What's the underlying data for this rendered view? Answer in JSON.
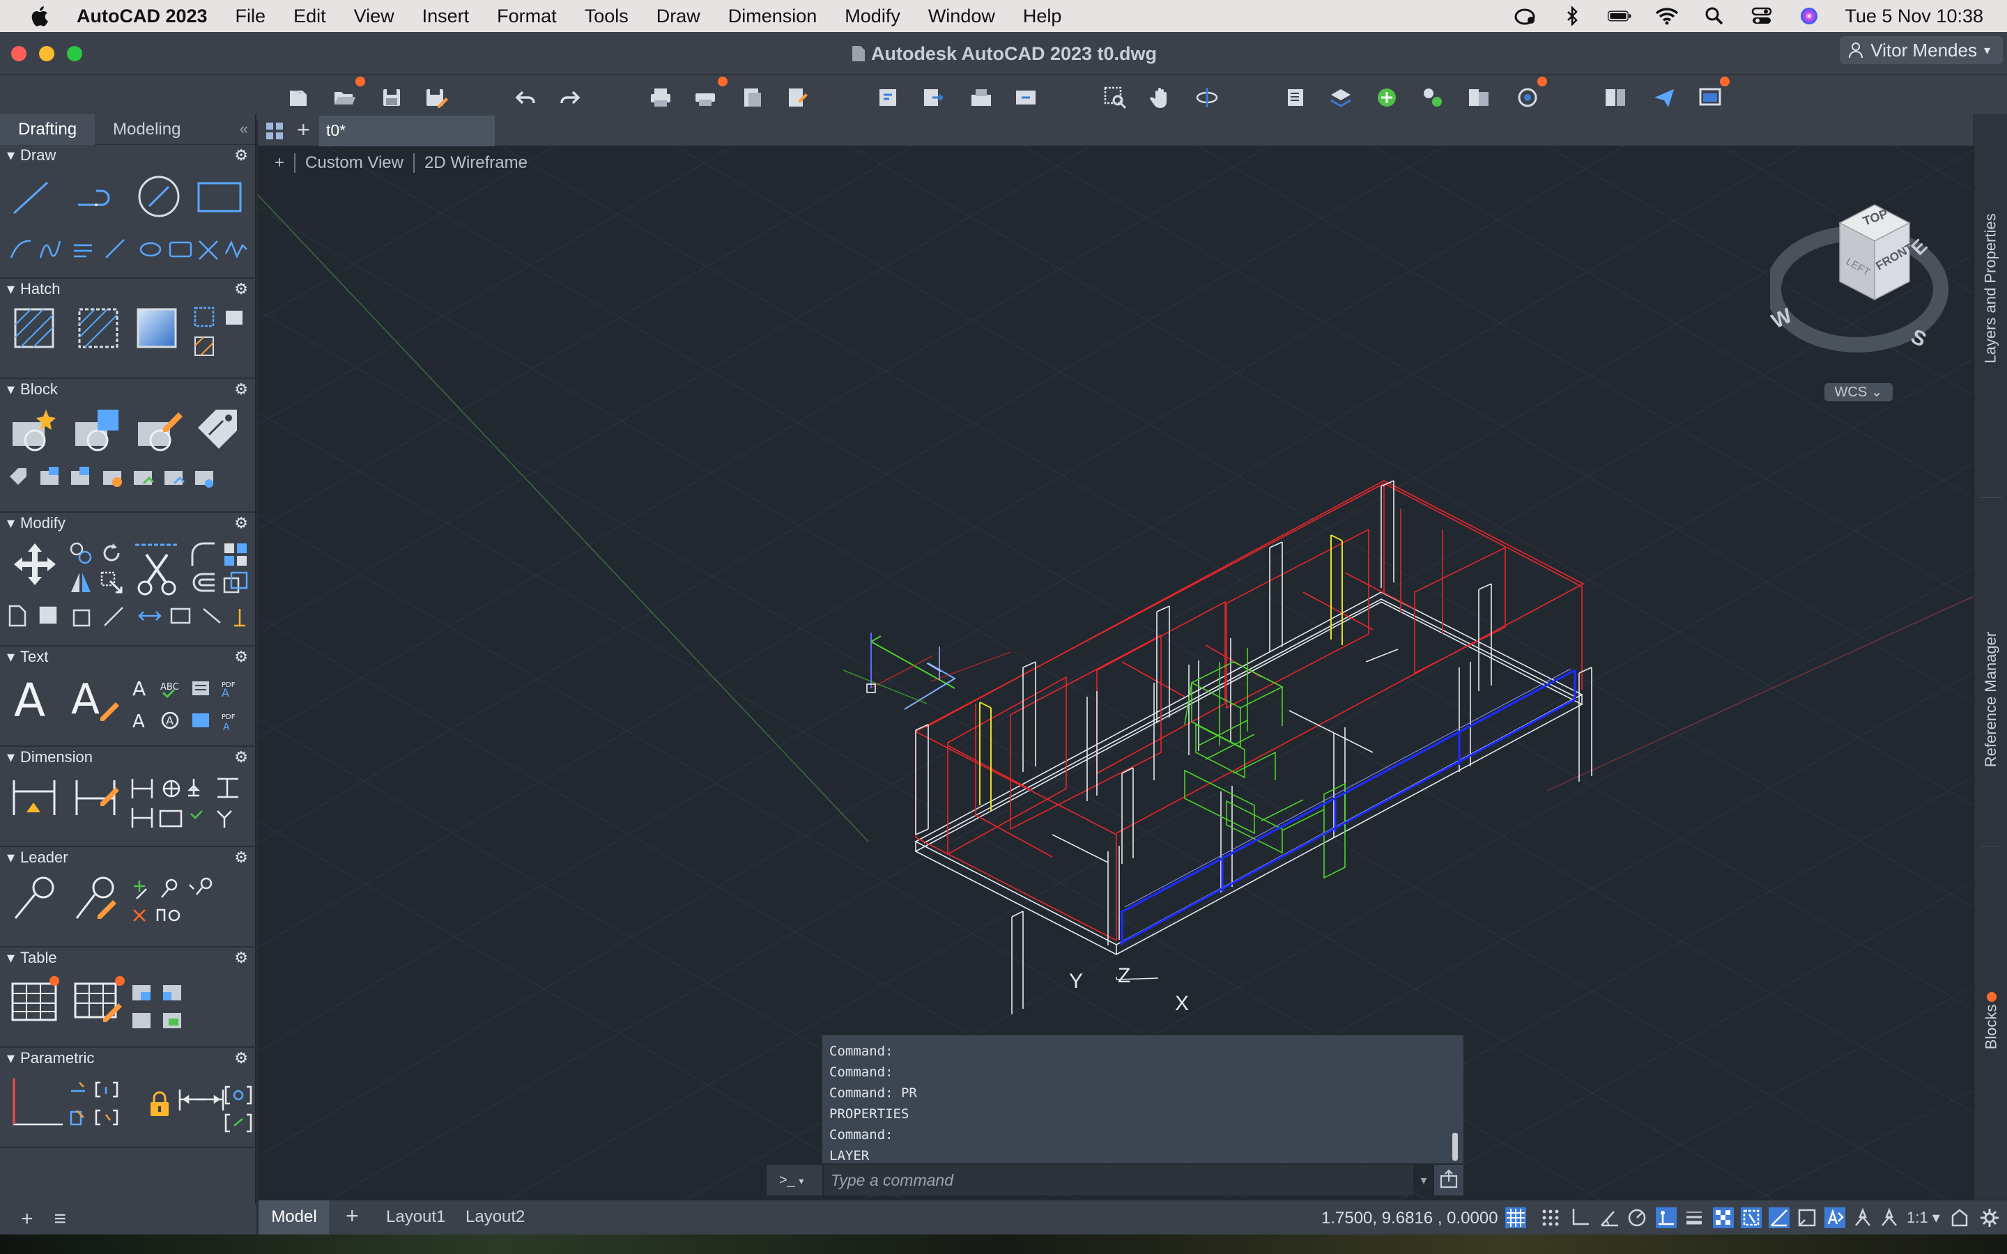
{
  "menubar": {
    "app_name": "AutoCAD 2023",
    "items": [
      "File",
      "Edit",
      "View",
      "Insert",
      "Format",
      "Tools",
      "Draw",
      "Dimension",
      "Modify",
      "Window",
      "Help"
    ],
    "clock": "Tue 5 Nov  10:38"
  },
  "window": {
    "title": "Autodesk AutoCAD 2023    t0.dwg",
    "user": "Vitor Mendes"
  },
  "palette": {
    "tabs": [
      "Drafting",
      "Modeling"
    ],
    "sections": [
      "Draw",
      "Hatch",
      "Block",
      "Modify",
      "Text",
      "Dimension",
      "Leader",
      "Table",
      "Parametric"
    ]
  },
  "doc_tab": "t0*",
  "view_controls": {
    "plus": "+",
    "view": "Custom View",
    "style": "2D Wireframe"
  },
  "viewcube": {
    "top": "TOP",
    "front": "FRONT",
    "left": "LEFT",
    "compass": [
      "W",
      "S",
      "E"
    ],
    "wcs": "WCS"
  },
  "ucs": {
    "x": "X",
    "y": "Y",
    "z": "Z"
  },
  "right_tabs": [
    "Layers and Properties",
    "Reference Manager",
    "Blocks"
  ],
  "command": {
    "history": [
      "Command:",
      "Command:",
      "Command: PR",
      "PROPERTIES",
      "Command:",
      "LAYER"
    ],
    "prompt": ">_",
    "placeholder": "Type a command"
  },
  "status": {
    "layouts": [
      "Model",
      "Layout1",
      "Layout2"
    ],
    "coords": "1.7500, 9.6816 , 0.0000",
    "scale": "1:1"
  },
  "colors": {
    "accent_blue": "#2f7bd8",
    "badge_orange": "#ff6a2b",
    "wall_red": "#e8262a",
    "window_blue": "#1c2cff",
    "door_yellow": "#e6dc2a",
    "furniture_green": "#4fd12a"
  }
}
